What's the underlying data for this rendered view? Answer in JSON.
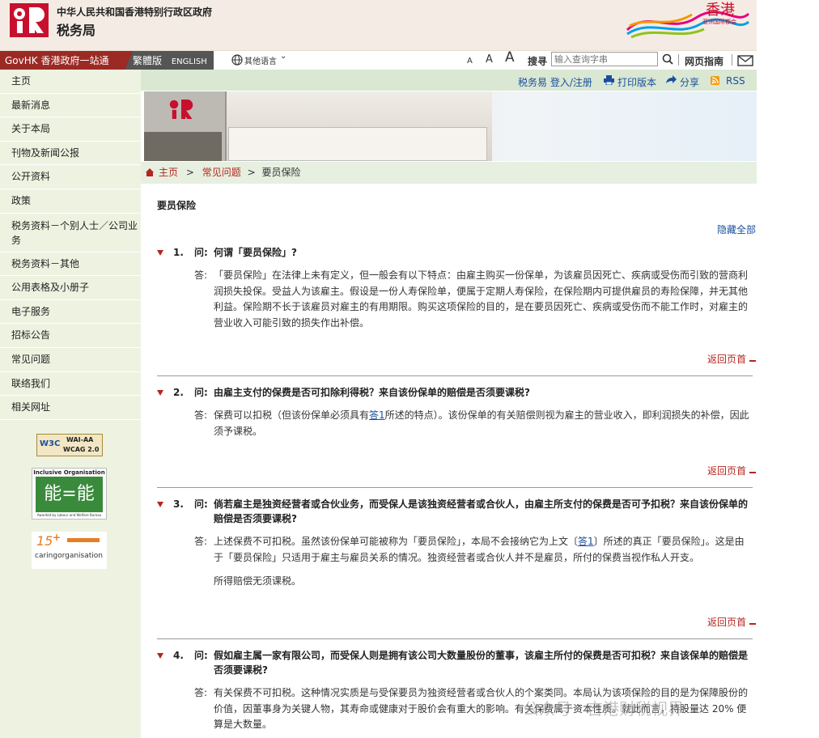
{
  "header": {
    "dept_cn_full": "中华人民共和国香港特别行政区政府",
    "dept_name": "税务局",
    "brand_text": "香港",
    "brand_subtext": "亚洲国际都会"
  },
  "topbar": {
    "govhk": "GovHK 香港政府一站通",
    "lang_trad": "繁體版",
    "lang_en": "ENGLISH",
    "other_lang": "其他语言",
    "font_small": "A",
    "font_medium": "A",
    "font_large": "A",
    "search_label": "搜寻",
    "search_placeholder": "输入查询字串",
    "sitemap": "网页指南"
  },
  "toolbar": {
    "etax": "税务易 登入/注册",
    "print": "打印版本",
    "share": "分享",
    "rss": "RSS"
  },
  "sidebar": {
    "items": [
      "主页",
      "最新消息",
      "关于本局",
      "刊物及新闻公报",
      "公开资料",
      "政策",
      "税务资料－个别人士／公司业务",
      "税务资料－其他",
      "公用表格及小册子",
      "电子服务",
      "招标公告",
      "常见问题",
      "联络我们",
      "相关网址"
    ],
    "badge_wcag_1": "WAI-AA",
    "badge_wcag_2": "WCAG 2.0",
    "badge_io_title": "Inclusive Organisation",
    "badge_io_sub": "Awarded by Labour and Welfare Bureau",
    "badge_caring": "caringorganisation",
    "badge_caring_num": "15"
  },
  "breadcrumb": {
    "home": "主页",
    "faq": "常见问题",
    "current": "要员保险",
    "sep": ">"
  },
  "main": {
    "title": "要员保险",
    "hide_all": "隐藏全部",
    "back_top": "返回页首",
    "q_label": "问:",
    "a_label": "答:",
    "qas": [
      {
        "num": "1.",
        "q": "何谓「要员保险」?",
        "a": "「要员保险」在法律上未有定义，但一般会有以下特点：由雇主购买一份保单，为该雇员因死亡、疾病或受伤而引致的营商利润损失投保。受益人为该雇主。假设是一份人寿保险单，便属于定期人寿保险，在保险期内可提供雇员的寿险保障，并无其他利益。保险期不长于该雇员对雇主的有用期限。购买这项保险的目的，是在要员因死亡、疾病或受伤而不能工作时，对雇主的营业收入可能引致的损失作出补偿。"
      },
      {
        "num": "2.",
        "q": "由雇主支付的保费是否可扣除利得税？来自该份保单的赔偿是否须要课税?",
        "a_pre": "保费可以扣税（但该份保单必须具有",
        "a_ref": "答1",
        "a_post": "所述的特点）。该份保单的有关赔偿则视为雇主的营业收入，即利润损失的补偿，因此须予课税。"
      },
      {
        "num": "3.",
        "q": "倘若雇主是独资经营者或合伙业务，而受保人是该独资经营者或合伙人，由雇主所支付的保费是否可予扣税？来自该份保单的赔偿是否须要课税?",
        "a_pre": "上述保费不可扣税。虽然该份保单可能被称为「要员保险」，本局不会接纳它为上文〔",
        "a_ref": "答1",
        "a_post": "〕所述的真正「要员保险」。这是由于「要员保险」只适用于雇主与雇员关系的情况。独资经营者或合伙人并不是雇员，所付的保费当视作私人开支。",
        "a2": "所得赔偿无须课税。"
      },
      {
        "num": "4.",
        "q": "假如雇主属一家有限公司，而受保人则是拥有该公司大数量股份的董事，该雇主所付的保费是否可扣税？来自该保单的赔偿是否须要课税?",
        "a": "有关保费不可扣税。这种情况实质是与受保要员为独资经营者或合伙人的个案类同。本局认为该项保险的目的是为保障股份的价值，因董事身为关键人物，其寿命或健康对于股价会有重大的影响。有关保费属于资本性质。就此而言，持股量达 20% 便算是大数量。"
      }
    ]
  },
  "watermark": "公众号 · 吉港财税视界"
}
